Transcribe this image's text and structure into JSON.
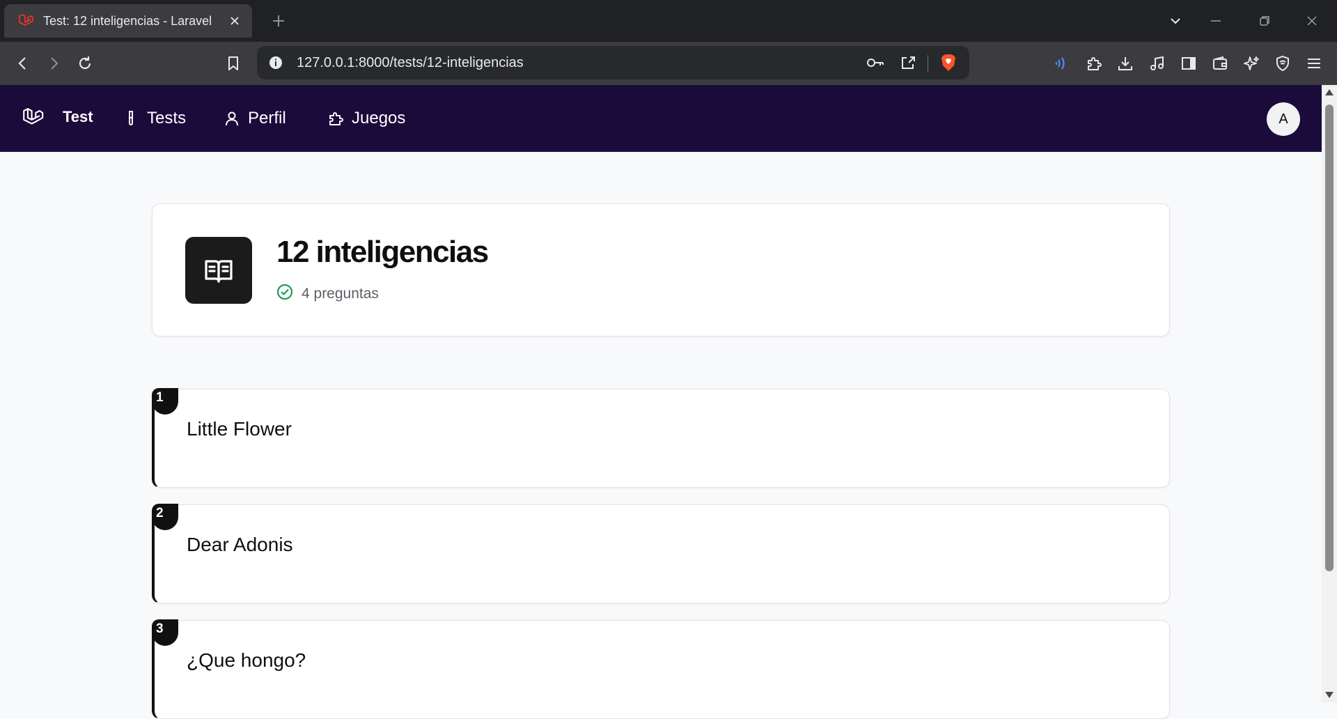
{
  "browser": {
    "tab": {
      "title": "Test: 12 inteligencias - Laravel"
    },
    "url": "127.0.0.1:8000/tests/12-inteligencias"
  },
  "nav": {
    "brand": "Test",
    "items": [
      {
        "label": "Tests",
        "icon": "test-tube-icon"
      },
      {
        "label": "Perfil",
        "icon": "user-icon"
      },
      {
        "label": "Juegos",
        "icon": "puzzle-icon"
      }
    ],
    "avatar_initial": "A"
  },
  "test": {
    "title": "12 inteligencias",
    "question_count": "4 preguntas"
  },
  "questions": [
    {
      "number": "1",
      "text": "Little Flower"
    },
    {
      "number": "2",
      "text": "Dear Adonis"
    },
    {
      "number": "3",
      "text": "¿Que hongo?"
    }
  ],
  "colors": {
    "nav_bg": "#1a0b3b",
    "check_green": "#1f9d55",
    "brave_orange": "#fb542b",
    "laravel_red": "#f9322c"
  }
}
